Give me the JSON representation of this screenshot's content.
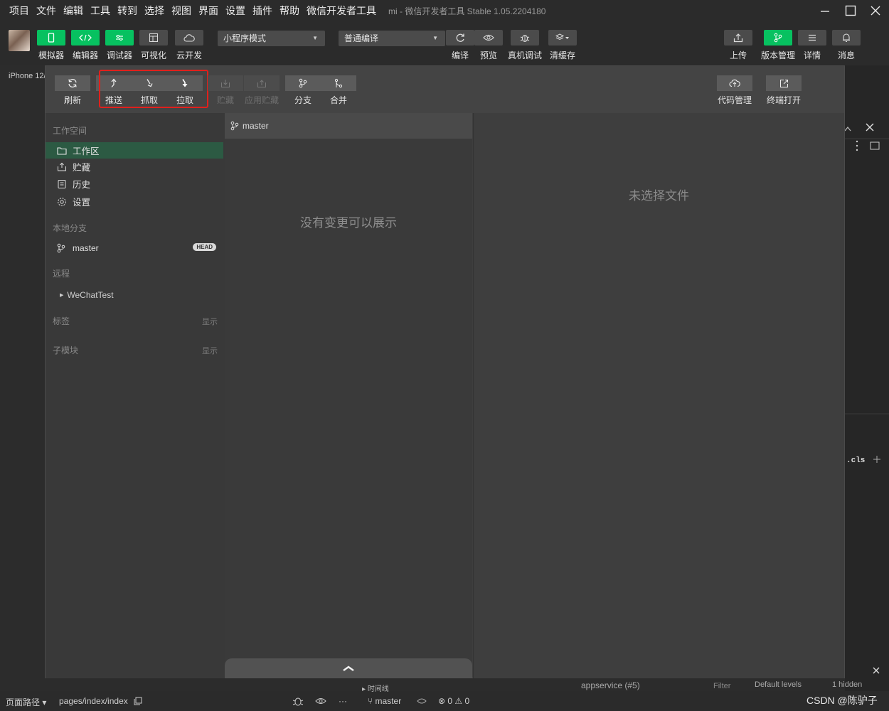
{
  "menubar": {
    "items": [
      "项目",
      "文件",
      "编辑",
      "工具",
      "转到",
      "选择",
      "视图",
      "界面",
      "设置",
      "插件",
      "帮助",
      "微信开发者工具"
    ],
    "window_title": "mi - 微信开发者工具 Stable 1.05.2204180"
  },
  "toolbar": {
    "left_buttons": [
      {
        "label": "模拟器",
        "icon": "phone-icon"
      },
      {
        "label": "编辑器",
        "icon": "code-icon"
      },
      {
        "label": "调试器",
        "icon": "debug-sliders-icon"
      },
      {
        "label": "可视化",
        "icon": "layout-icon"
      },
      {
        "label": "云开发",
        "icon": "cloud-icon"
      }
    ],
    "mode_select": "小程序模式",
    "compile_select": "普通编译",
    "mid_buttons": [
      {
        "label": "编译",
        "icon": "refresh-icon"
      },
      {
        "label": "预览",
        "icon": "eye-icon"
      },
      {
        "label": "真机调试",
        "icon": "bug-icon"
      },
      {
        "label": "清缓存",
        "icon": "layers-icon"
      }
    ],
    "right_buttons": [
      {
        "label": "上传",
        "icon": "upload-icon"
      },
      {
        "label": "版本管理",
        "icon": "branch-icon"
      },
      {
        "label": "详情",
        "icon": "menu-icon"
      },
      {
        "label": "消息",
        "icon": "bell-icon"
      }
    ],
    "device_label": "iPhone 12/"
  },
  "version": {
    "toolbar": {
      "refresh": "刷新",
      "push": "推送",
      "fetch": "抓取",
      "pull": "拉取",
      "stash": "贮藏",
      "apply_stash": "应用贮藏",
      "branch": "分支",
      "merge": "合并",
      "code_manage": "代码管理",
      "open_terminal": "终端打开"
    },
    "sidebar": {
      "workspace_title": "工作空间",
      "workspace_items": [
        "工作区",
        "贮藏",
        "历史",
        "设置"
      ],
      "local_branch_title": "本地分支",
      "local_branch": "master",
      "head_badge": "HEAD",
      "remote_title": "远程",
      "remote_item": "WeChatTest",
      "tags_title": "标签",
      "tags_show": "显示",
      "submodule_title": "子模块",
      "submodule_show": "显示"
    },
    "middle": {
      "branch": "master",
      "empty_text": "没有变更可以展示"
    },
    "right": {
      "empty_text": "未选择文件"
    }
  },
  "statusbar": {
    "page_path": "页面路径",
    "page": "pages/index/index",
    "branch": "master",
    "errors": "0",
    "warnings": "0",
    "timeline": "时间线",
    "context": "appservice (#5)",
    "filter": "Filter",
    "levels": "Default levels",
    "hidden": "1 hidden",
    "watermark": "CSDN @陈驴子"
  },
  "colors": {
    "accent_green": "#07c160",
    "active_item": "#2c5a43",
    "highlight_red": "#e0201c"
  }
}
